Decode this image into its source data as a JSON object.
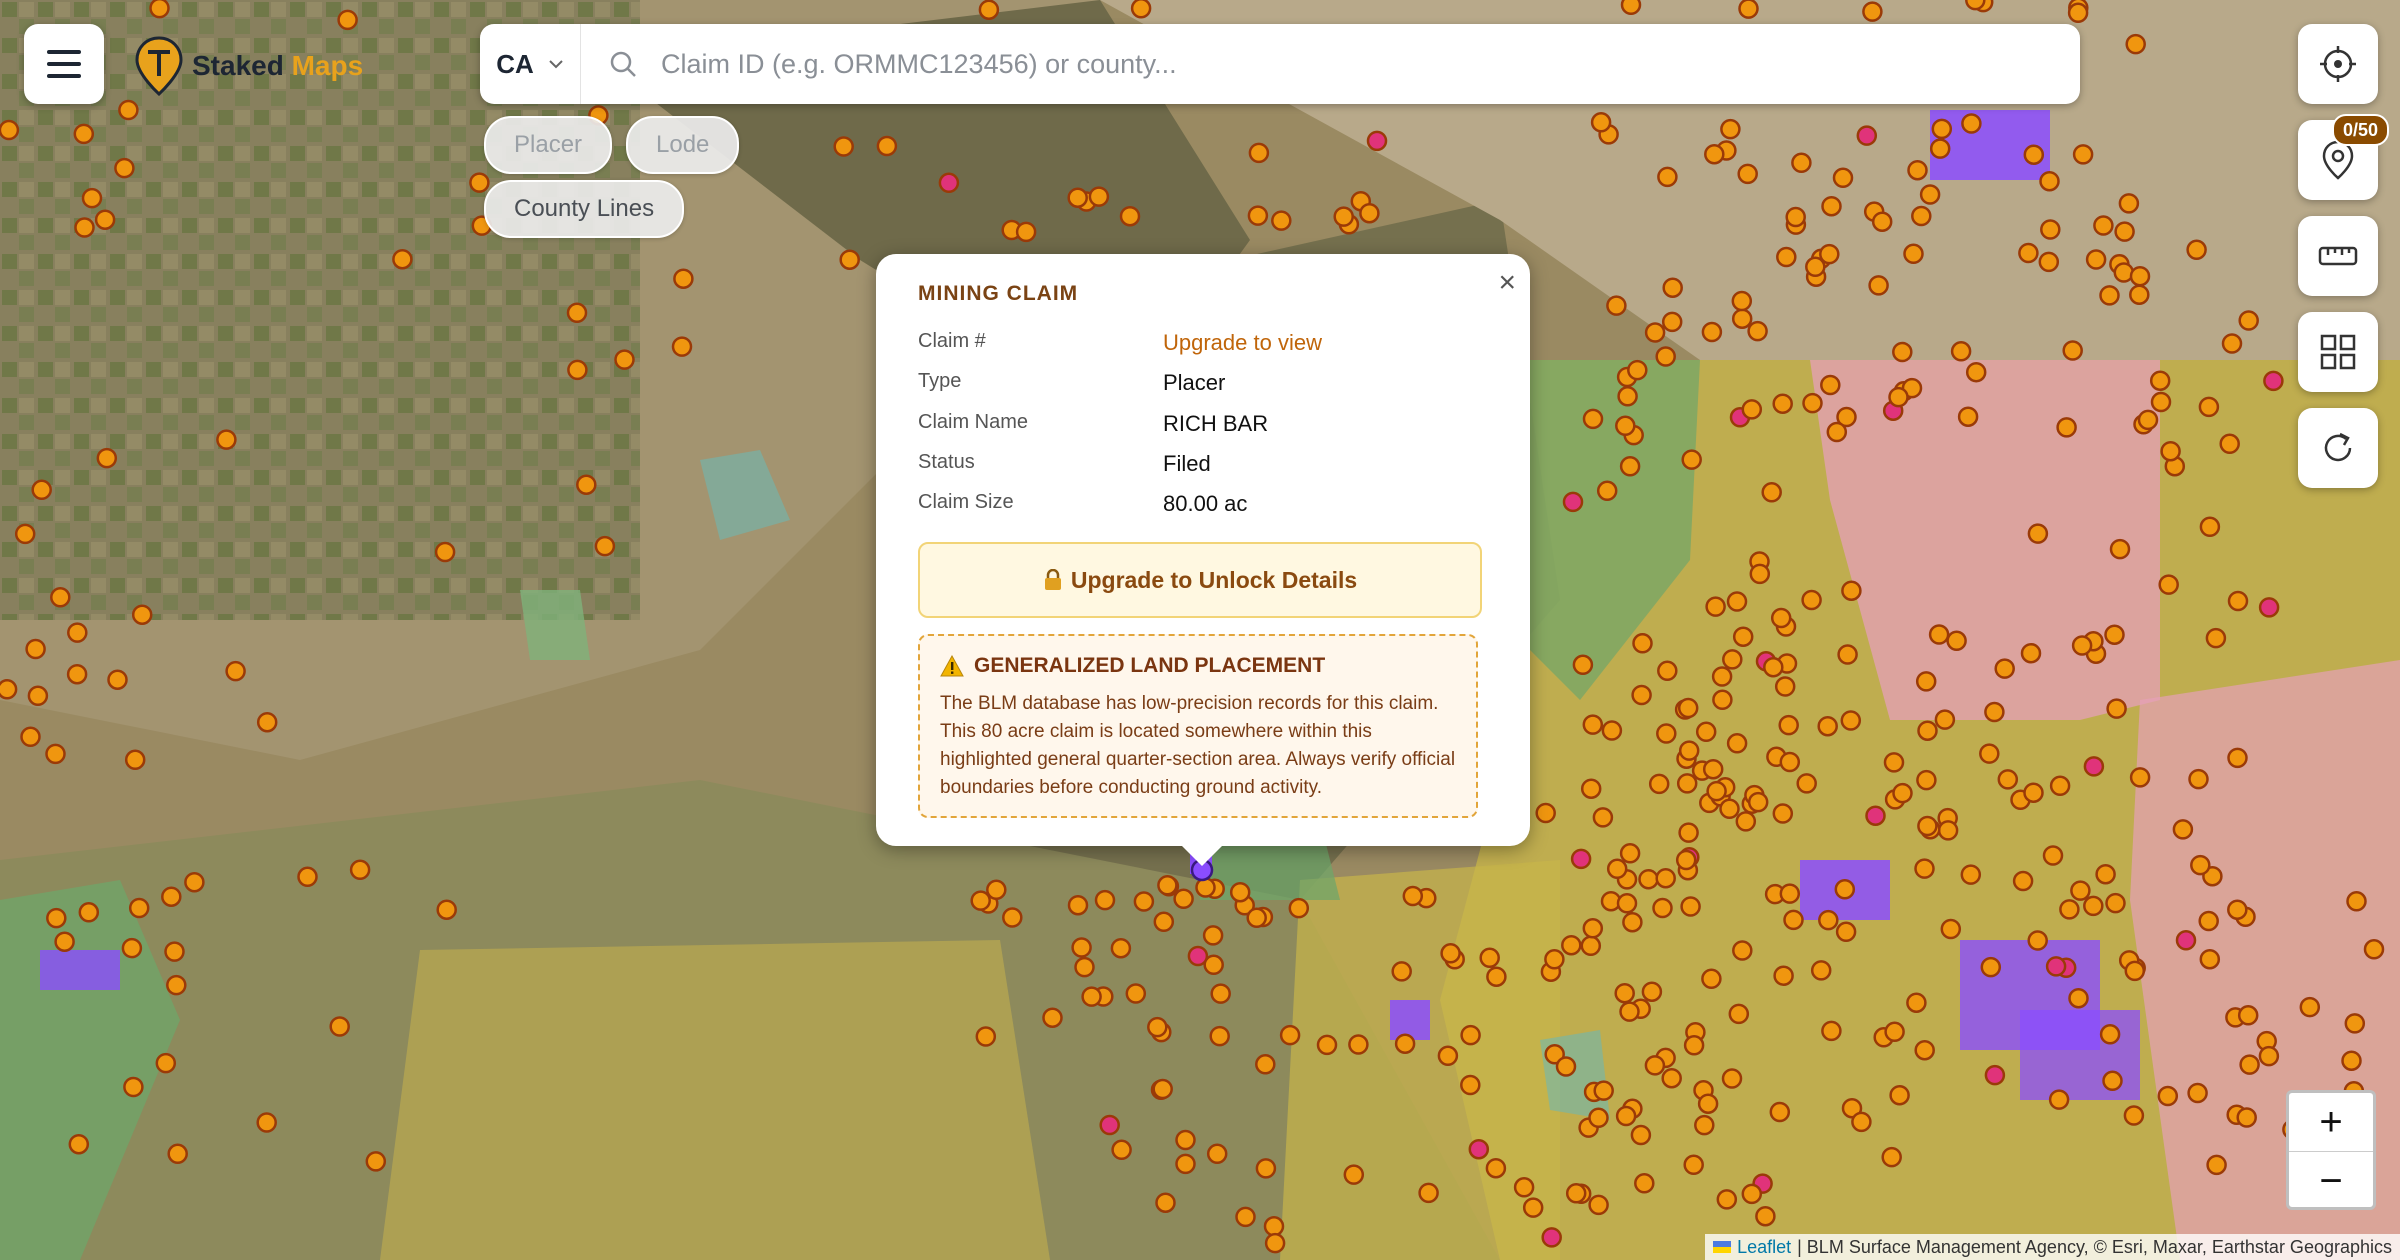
{
  "app": {
    "brand_part1": "Staked",
    "brand_part2": "Maps"
  },
  "search": {
    "state": "CA",
    "placeholder": "Claim ID (e.g. ORMMC123456) or county..."
  },
  "filters": [
    {
      "label": "Placer",
      "active": false
    },
    {
      "label": "Lode",
      "active": false
    },
    {
      "label": "County Lines",
      "active": true
    }
  ],
  "toolbar": {
    "locate_icon": "crosshair-icon",
    "pins_icon": "map-pin-icon",
    "pins_count": "0/50",
    "measure_icon": "ruler-icon",
    "layers_icon": "grid-icon",
    "refresh_icon": "refresh-icon"
  },
  "popup": {
    "title": "MINING CLAIM",
    "rows": [
      {
        "key": "Claim #",
        "value": "Upgrade to view"
      },
      {
        "key": "Type",
        "value": "Placer"
      },
      {
        "key": "Claim Name",
        "value": "RICH BAR"
      },
      {
        "key": "Status",
        "value": "Filed"
      },
      {
        "key": "Claim Size",
        "value": "80.00 ac"
      }
    ],
    "unlock_label": "Upgrade to Unlock Details",
    "warning_title": "GENERALIZED LAND PLACEMENT",
    "warning_text": "The BLM database has low-precision records for this claim. This 80 acre claim is located somewhere within this highlighted general quarter-section area. Always verify official boundaries before conducting ground activity."
  },
  "zoom": {
    "in": "+",
    "out": "−"
  },
  "attribution": {
    "leaflet": "Leaflet",
    "rest": "| BLM Surface Management Agency, © Esri, Maxar, Earthstar Geographics"
  },
  "colors": {
    "claim_dot": "#f0960f",
    "claim_dot_stroke": "#9a3a08",
    "placer_square": "#8b4dff",
    "highlight_dot": "#e0337a",
    "blm_land": "#d7c24a",
    "forest_land": "#6fa56a",
    "military_land": "#e6a0b8",
    "accent": "#e8a21c"
  }
}
